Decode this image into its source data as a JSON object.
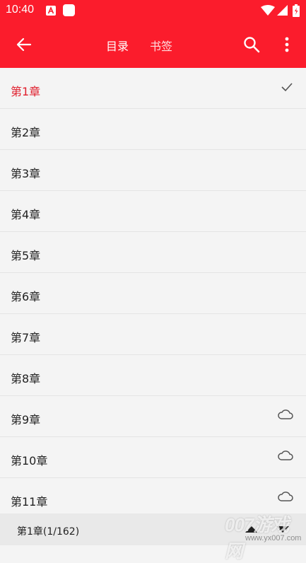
{
  "status_bar": {
    "time": "10:40",
    "notif_a_icon": "a-notification-icon",
    "notif_b_icon": "app-notification-icon"
  },
  "app_bar": {
    "back_icon": "arrow-left-icon",
    "tabs": [
      {
        "label": "目录",
        "active": true
      },
      {
        "label": "书签",
        "active": false
      }
    ],
    "search_icon": "search-icon",
    "more_icon": "more-vertical-icon"
  },
  "chapters": [
    {
      "label": "第1章",
      "status": "current"
    },
    {
      "label": "第2章",
      "status": "none"
    },
    {
      "label": "第3章",
      "status": "none"
    },
    {
      "label": "第4章",
      "status": "none"
    },
    {
      "label": "第5章",
      "status": "none"
    },
    {
      "label": "第6章",
      "status": "none"
    },
    {
      "label": "第7章",
      "status": "none"
    },
    {
      "label": "第8章",
      "status": "none"
    },
    {
      "label": "第9章",
      "status": "cloud"
    },
    {
      "label": "第10章",
      "status": "cloud"
    },
    {
      "label": "第11章",
      "status": "cloud"
    }
  ],
  "bottom_bar": {
    "progress_text": "第1章(1/162)"
  },
  "watermark": {
    "logo_text": "007游戏网",
    "url": "www.yx007.com"
  },
  "colors": {
    "brand_red": "#fb1c2c",
    "current_chapter": "#e0202e"
  }
}
